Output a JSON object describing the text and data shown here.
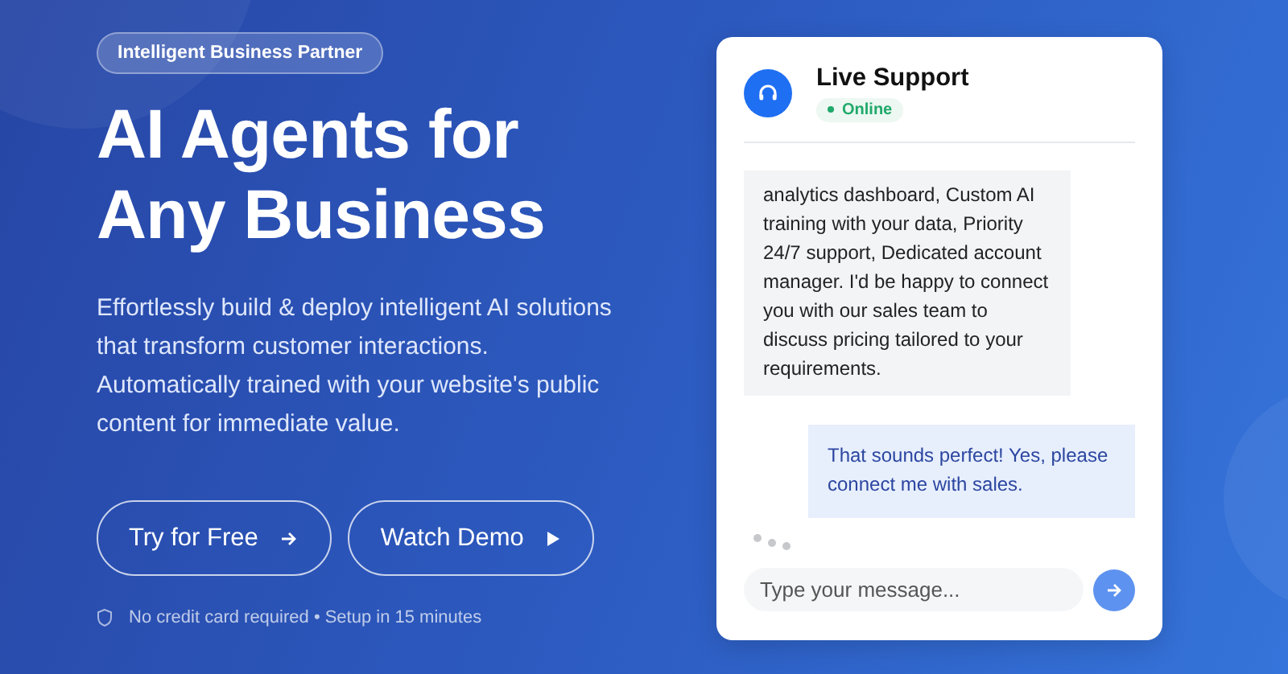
{
  "hero": {
    "badge": "Intelligent Business Partner",
    "headline_lines": [
      "AI Agents for",
      "Any Business"
    ],
    "description": "Effortlessly build & deploy intelligent AI solutions that transform customer interactions. Automatically trained with your website's public content for immediate value.",
    "buttons": [
      {
        "label": "Try for Free"
      },
      {
        "label": "Watch Demo"
      }
    ],
    "note": "No credit card required • Setup in 15 minutes"
  },
  "chat": {
    "title": "Live Support",
    "status": "Online",
    "messages": [
      {
        "kind": "bot",
        "text": "analytics dashboard, Custom AI training with your data, Priority 24/7 support, Dedicated account manager. I'd be happy to connect you with our sales team to discuss pricing tailored to your requirements."
      },
      {
        "kind": "user",
        "text": "That sounds perfect! Yes, please connect me with sales."
      }
    ],
    "typing": true,
    "input": {
      "placeholder": "Type your message..."
    }
  }
}
